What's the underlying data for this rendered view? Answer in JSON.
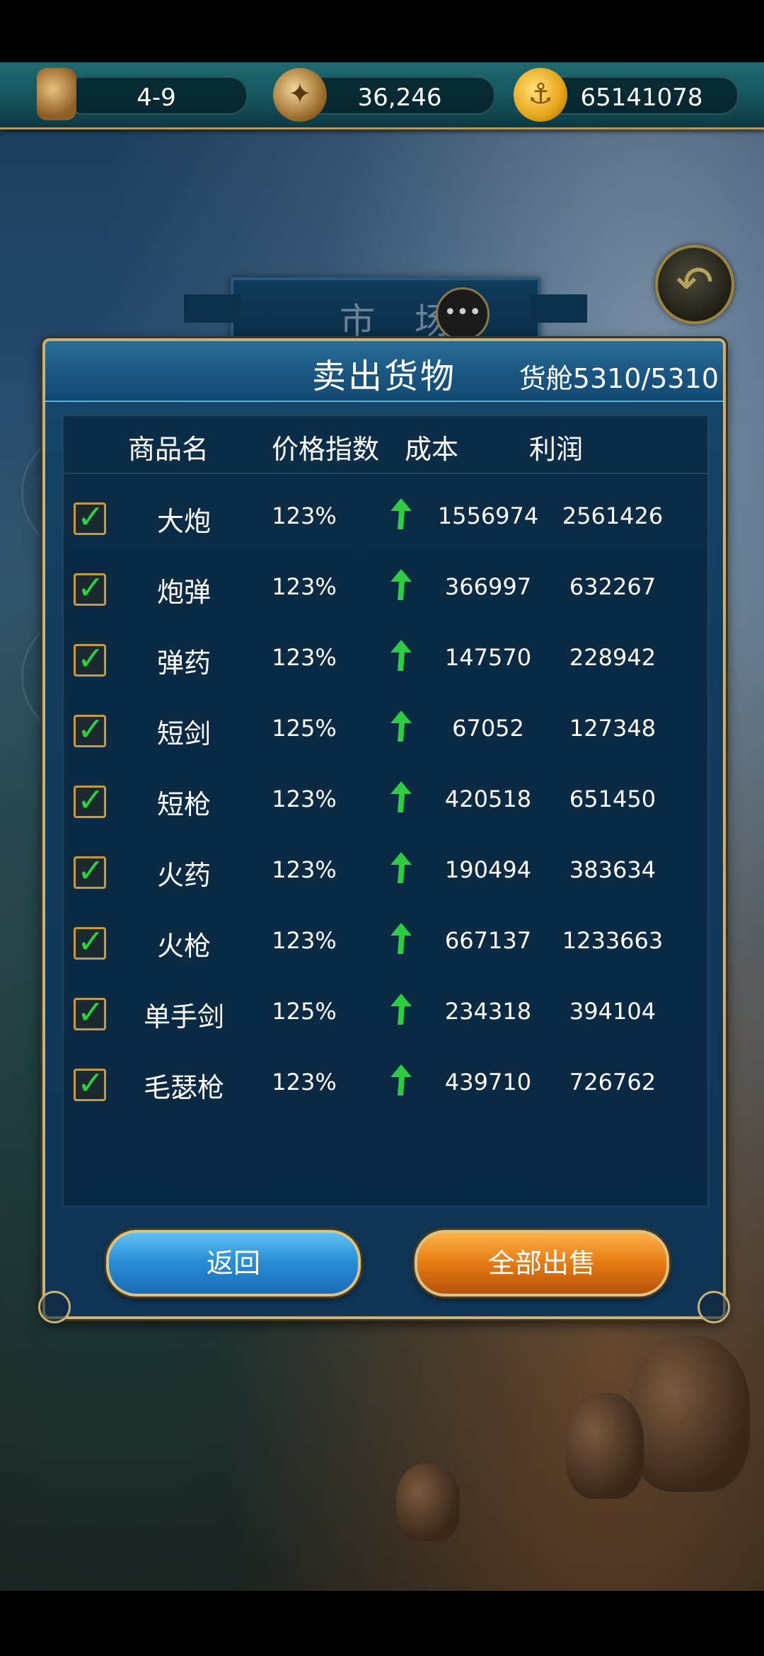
{
  "top_bar": {
    "time_value": "4-9",
    "compass_value": "36,246",
    "gold_value": "65141078"
  },
  "market": {
    "title": "市 场"
  },
  "panel": {
    "title": "卖出货物",
    "cargo": "货舱5310/5310",
    "columns": {
      "name": "商品名",
      "price_index": "价格指数",
      "cost": "成本",
      "profit": "利润"
    },
    "rows": [
      {
        "name": "大炮",
        "price_index": "123%",
        "cost": "1556974",
        "profit": "2561426",
        "checked": true
      },
      {
        "name": "炮弹",
        "price_index": "123%",
        "cost": "366997",
        "profit": "632267",
        "checked": true
      },
      {
        "name": "弹药",
        "price_index": "123%",
        "cost": "147570",
        "profit": "228942",
        "checked": true
      },
      {
        "name": "短剑",
        "price_index": "125%",
        "cost": "67052",
        "profit": "127348",
        "checked": true
      },
      {
        "name": "短枪",
        "price_index": "123%",
        "cost": "420518",
        "profit": "651450",
        "checked": true
      },
      {
        "name": "火药",
        "price_index": "123%",
        "cost": "190494",
        "profit": "383634",
        "checked": true
      },
      {
        "name": "火枪",
        "price_index": "123%",
        "cost": "667137",
        "profit": "1233663",
        "checked": true
      },
      {
        "name": "单手剑",
        "price_index": "125%",
        "cost": "234318",
        "profit": "394104",
        "checked": true
      },
      {
        "name": "毛瑟枪",
        "price_index": "123%",
        "cost": "439710",
        "profit": "726762",
        "checked": true
      }
    ],
    "trend_icon": "up-arrow-icon",
    "trend_color": "#2ecc40"
  },
  "buttons": {
    "back_label": "返回",
    "sell_all_label": "全部出售"
  },
  "colors": {
    "panel_border": "#c7b27a",
    "back_button": "#2a8fd8",
    "sell_button": "#e67b12"
  }
}
